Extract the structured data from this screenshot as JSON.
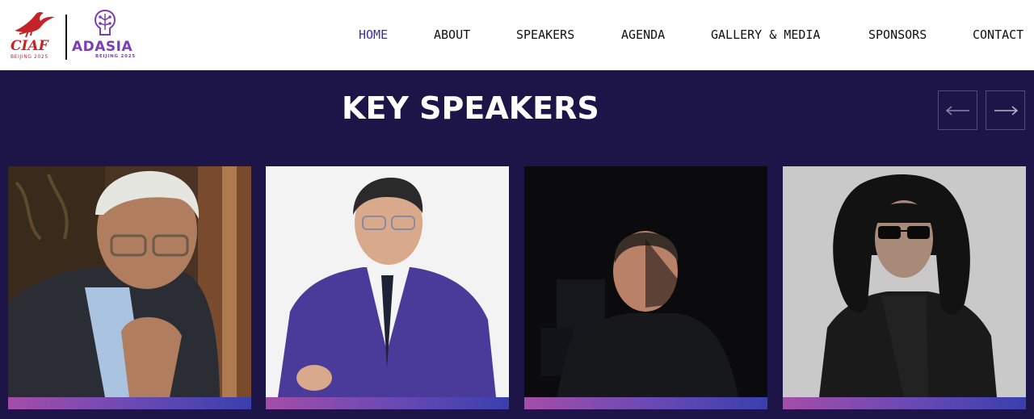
{
  "header": {
    "logo_left": {
      "name": "CIAF",
      "subtitle": "BEIJING 2025",
      "brand_color": "#c4232a"
    },
    "logo_right": {
      "name": "ADASIA",
      "subtitle": "BEIJING 2025",
      "brand_color": "#7b3fb5"
    },
    "nav": [
      {
        "label": "HOME",
        "active": true
      },
      {
        "label": "ABOUT",
        "active": false
      },
      {
        "label": "SPEAKERS",
        "active": false
      },
      {
        "label": "AGENDA",
        "active": false
      },
      {
        "label": "GALLERY & MEDIA",
        "active": false
      },
      {
        "label": "SPONSORS",
        "active": false
      },
      {
        "label": "CONTACT",
        "active": false
      }
    ]
  },
  "section": {
    "title": "KEY SPEAKERS",
    "prev_icon": "arrow-left-icon",
    "next_icon": "arrow-right-icon"
  },
  "speakers": [
    {
      "photo": "speaker-photo"
    },
    {
      "photo": "speaker-photo"
    },
    {
      "photo": "speaker-photo"
    },
    {
      "photo": "speaker-photo"
    }
  ],
  "colors": {
    "background": "#1d1447",
    "header": "#ffffff",
    "nav_active": "#3b2db0",
    "bar_gradient": [
      "#a44da8",
      "#3a3fae"
    ]
  }
}
